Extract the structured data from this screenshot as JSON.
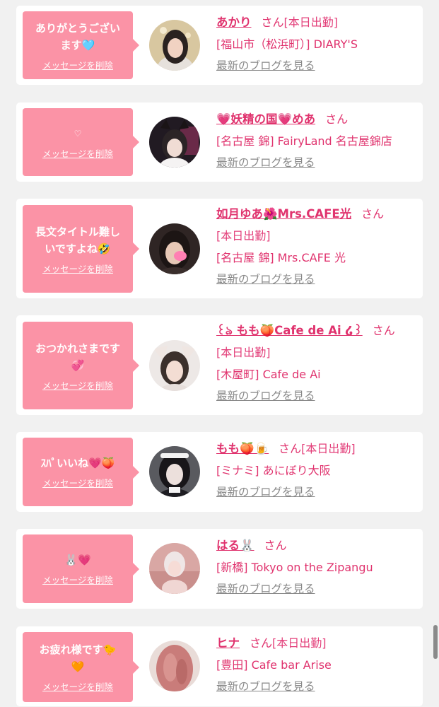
{
  "delete_label": "メッセージを削除",
  "blog_label": "最新のブログを見る",
  "san": "さん",
  "accent": "#e0336e",
  "bubble_color": "#fb93a6",
  "items": [
    {
      "message_lines": [
        "ありがとうござい",
        "ます🩵"
      ],
      "name": "あかり",
      "status": "[本日出勤]",
      "shop": "[福山市（松浜町）] DIARY'S"
    },
    {
      "message_lines": [
        "♡"
      ],
      "name": "💗妖精の国💗めあ",
      "status": "",
      "shop": "[名古屋 錦] FairyLand 名古屋錦店"
    },
    {
      "message_lines": [
        "長文タイトル難し",
        "いですよね🤣"
      ],
      "name": "如月ゆあ🌺Mrs.CAFE光",
      "status": "[本日出勤]",
      "shop": "[名古屋 錦] Mrs.CAFE 光"
    },
    {
      "message_lines": [
        "おつかれさまです",
        "💞"
      ],
      "name": "꒰ঌ もも🍑Cafe de Ai ໒꒱",
      "status": "[本日出勤]",
      "shop": "[木屋町] Cafe de Ai"
    },
    {
      "message_lines": [
        "ｽﾊﾟいいね💗🍑"
      ],
      "name": "もも🍑🍺",
      "status": "[本日出勤]",
      "shop": "[ミナミ] あにぼり大阪"
    },
    {
      "message_lines": [
        "🐰💗"
      ],
      "name": "はる🐰",
      "status": "",
      "shop": "[新橋] Tokyo on the Zipangu"
    },
    {
      "message_lines": [
        "お疲れ様です🐤",
        "🧡"
      ],
      "name": "ヒナ",
      "status": "[本日出勤]",
      "shop": "[豊田] Cafe bar Arise"
    }
  ]
}
